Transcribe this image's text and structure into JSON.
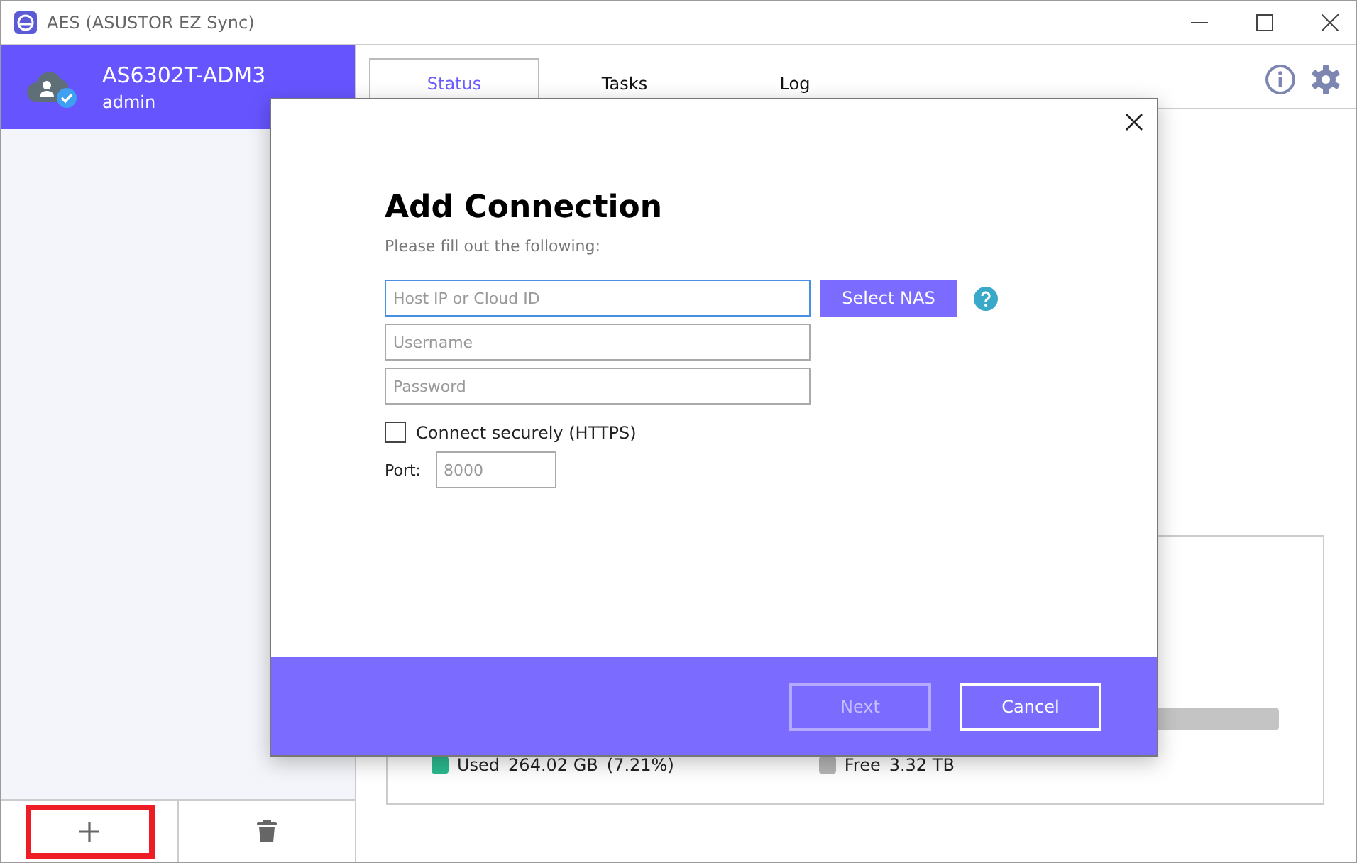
{
  "window": {
    "title": "AES (ASUSTOR EZ Sync)"
  },
  "sidebar": {
    "device": {
      "name": "AS6302T-ADM3",
      "user": "admin"
    },
    "footer_buttons": [
      {
        "kind": "add",
        "highlighted": true
      },
      {
        "kind": "delete",
        "highlighted": false
      }
    ]
  },
  "tabs": [
    {
      "label": "Status",
      "selected": true
    },
    {
      "label": "Tasks",
      "selected": false
    },
    {
      "label": "Log",
      "selected": false
    }
  ],
  "storage": {
    "legend": [
      {
        "label": "Used",
        "value": "264.02 GB",
        "percent": "(7.21%)",
        "color": "#2bb98e"
      },
      {
        "label": "Free",
        "value": "3.32 TB",
        "color": "#b4b4b4"
      }
    ]
  },
  "dialog": {
    "title": "Add Connection",
    "subtitle": "Please fill out the following:",
    "fields": [
      {
        "placeholder": "Host IP or Cloud ID",
        "focused": true
      },
      {
        "placeholder": "Username",
        "focused": false
      },
      {
        "placeholder": "Password",
        "focused": false
      }
    ],
    "select_button": "Select NAS",
    "checkbox": {
      "label": "Connect securely (HTTPS)",
      "checked": false
    },
    "port": {
      "label": "Port:",
      "placeholder": "8000"
    },
    "buttons": [
      {
        "label": "Next",
        "disabled": true
      },
      {
        "label": "Cancel",
        "disabled": false
      }
    ]
  }
}
